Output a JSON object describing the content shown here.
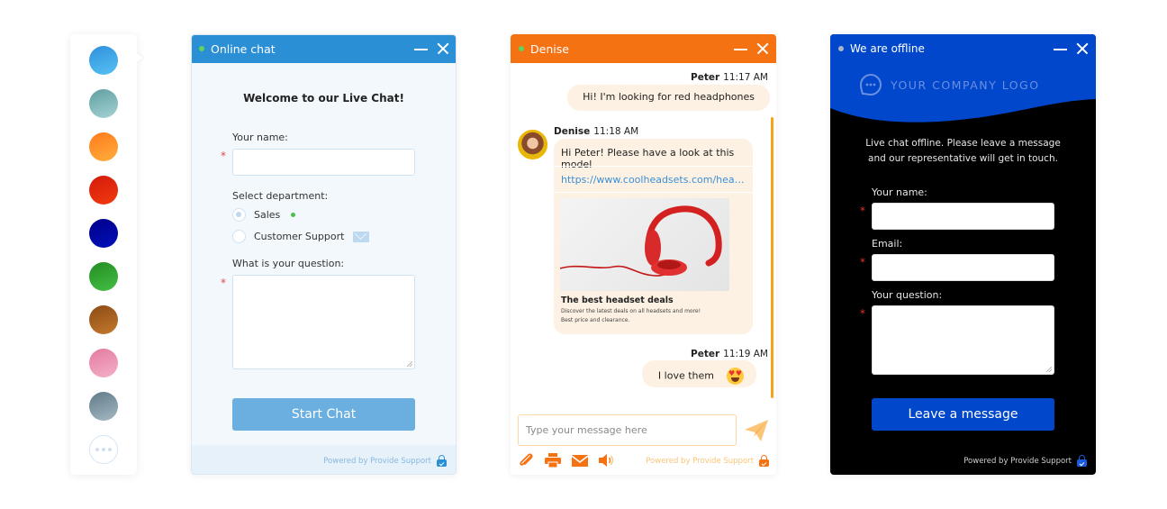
{
  "palette": {
    "swatches": [
      {
        "name": "blue",
        "from": "#2f8fdc",
        "to": "#56c2f2"
      },
      {
        "name": "teal",
        "from": "#5f9ea0",
        "to": "#a6d3d6"
      },
      {
        "name": "orange",
        "from": "#ff7a1a",
        "to": "#ffae3d"
      },
      {
        "name": "red",
        "from": "#d41a0a",
        "to": "#f03a10"
      },
      {
        "name": "navy",
        "from": "#00008a",
        "to": "#0010b8"
      },
      {
        "name": "green",
        "from": "#238c23",
        "to": "#44c044"
      },
      {
        "name": "brown",
        "from": "#8c4a14",
        "to": "#c47a2e"
      },
      {
        "name": "pink",
        "from": "#e47aa0",
        "to": "#f4b0c8"
      },
      {
        "name": "slate",
        "from": "#607a88",
        "to": "#a4bac4"
      }
    ],
    "more_icon": "ellipsis-icon"
  },
  "online_window": {
    "title": "Online chat",
    "status_color": "#5fd35b",
    "header_color": "#2b8fd6",
    "welcome": "Welcome to our Live Chat!",
    "name_label": "Your name:",
    "name_value": "",
    "department_label": "Select department:",
    "departments": [
      {
        "label": "Sales",
        "selected": true,
        "status": "online"
      },
      {
        "label": "Customer Support",
        "selected": false,
        "status": "offline-mail"
      }
    ],
    "question_label": "What is your question:",
    "question_value": "",
    "start_button": "Start Chat",
    "powered_by": "Powered by Provide Support"
  },
  "chat_window": {
    "title": "Denise",
    "status_color": "#5fd35b",
    "header_color": "#f57213",
    "messages": [
      {
        "sender": "Peter",
        "time": "11:17 AM",
        "text": "Hi! I'm looking for red headphones",
        "side": "right"
      },
      {
        "sender": "Denise",
        "time": "11:18 AM",
        "text": "Hi Peter! Please have a look at this model",
        "side": "left",
        "link": "https://www.coolheadsets.com/headpho...",
        "card_title": "The best headset deals",
        "card_desc_1": "Discover the latest deals on all headsets and more!",
        "card_desc_2": "Best price and clearance."
      },
      {
        "sender": "Peter",
        "time": "11:19 AM",
        "text": "I love them",
        "side": "right",
        "emoji": "heart-eyes"
      }
    ],
    "input_placeholder": "Type your message here",
    "input_value": "",
    "toolbar": [
      "paperclip-icon",
      "printer-icon",
      "mail-icon",
      "sound-icon"
    ],
    "powered_by": "Powered by Provide Support"
  },
  "offline_window": {
    "title": "We are offline",
    "status_color": "#aab4c4",
    "header_color": "#0047cc",
    "logo_text": "YOUR COMPANY LOGO",
    "intro_line1": "Live chat offline. Please leave a message",
    "intro_line2": "and our representative will get in touch.",
    "name_label": "Your name:",
    "email_label": "Email:",
    "question_label": "Your question:",
    "leave_button": "Leave a message",
    "powered_by": "Powered by Provide Support"
  }
}
